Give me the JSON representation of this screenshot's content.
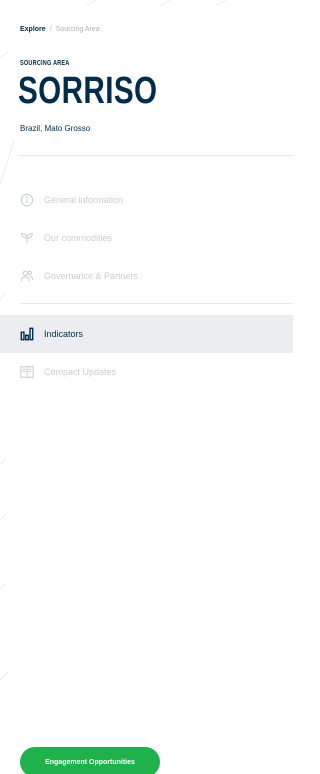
{
  "breadcrumb": {
    "root": "Explore",
    "separator": "/",
    "current": "Sourcing Area"
  },
  "header": {
    "kicker": "SOURCING AREA",
    "title": "SORRISO",
    "subtitle": "Brazil, Mato Grosso"
  },
  "nav": {
    "items": [
      {
        "label": "General information",
        "icon": "info-circle-icon",
        "active": false
      },
      {
        "label": "Our commodities",
        "icon": "sprout-icon",
        "active": false
      },
      {
        "label": "Governance & Partners",
        "icon": "people-icon",
        "active": false
      },
      {
        "label": "Indicators",
        "icon": "bar-chart-icon",
        "active": true
      },
      {
        "label": "Compact Updates",
        "icon": "open-book-icon",
        "active": false
      }
    ]
  },
  "cta": {
    "label": "Engagement Opportunities"
  },
  "colors": {
    "primary_text": "#002d4a",
    "muted_text": "#c9ced3",
    "active_bg": "#ebedf0",
    "cta_bg": "#1fb14a"
  }
}
